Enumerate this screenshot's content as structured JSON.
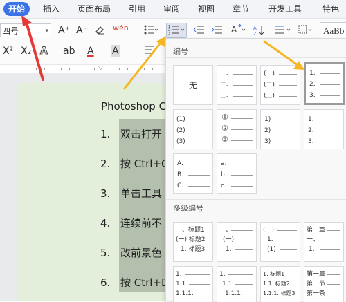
{
  "menubar": {
    "tabs": [
      "开始",
      "插入",
      "页面布局",
      "引用",
      "审阅",
      "视图",
      "章节",
      "开发工具",
      "特色"
    ]
  },
  "toolbar": {
    "font_size_value": "四号",
    "grow_font": "A⁺",
    "shrink_font": "A⁻",
    "phonetic": "wén",
    "superscript": "X²",
    "subscript": "X₂",
    "outline_text": "A",
    "highlight_text": "ab",
    "font_color_text": "A",
    "char_shading_text": "A",
    "sort_label": "AZ",
    "style_preview": "AaBb"
  },
  "colors": {
    "accent": "#3b73e6",
    "annotation_red": "#e53935",
    "annotation_orange": "#f5b622",
    "doc_page": "#e3efdb",
    "selection": "#b4c0ae"
  },
  "icons": {
    "bullet_list": "bulleted-list-icon",
    "numbered_list": "numbered-list-icon",
    "indent_decrease": "decrease-indent-icon",
    "indent_increase": "increase-indent-icon",
    "eraser": "eraser-icon",
    "line_spacing": "line-spacing-icon",
    "sort": "sort-icon"
  },
  "document": {
    "title": "Photoshop C",
    "items": [
      {
        "num": "1.",
        "text": "双击打开"
      },
      {
        "num": "2.",
        "text": "按 Ctrl+O"
      },
      {
        "num": "3.",
        "text": "单击工具"
      },
      {
        "num": "4.",
        "text": "连续前不"
      },
      {
        "num": "5.",
        "text": "改前景色"
      },
      {
        "num": "6.",
        "text": "按 Ctrl+D"
      }
    ]
  },
  "numbering_panel": {
    "section_numbering": "编号",
    "section_multilevel": "多级编号",
    "none_label": "无",
    "cards": [
      {
        "id": "none",
        "markers": []
      },
      {
        "id": "chinese-comma",
        "markers": [
          "一、",
          "二、",
          "三、"
        ]
      },
      {
        "id": "chinese-paren",
        "markers": [
          "(一)",
          "(二)",
          "(三)"
        ]
      },
      {
        "id": "arabic-dot",
        "markers": [
          "1.",
          "2.",
          "3."
        ]
      },
      {
        "id": "arabic-paren",
        "markers": [
          "(1)",
          "(2)",
          "(3)"
        ]
      },
      {
        "id": "circled",
        "markers": [
          "①",
          "②",
          "③"
        ]
      },
      {
        "id": "arabic-rparen",
        "markers": [
          "1)",
          "2)",
          "3)"
        ]
      },
      {
        "id": "arabic-dot-2",
        "markers": [
          "1.",
          "2.",
          "3."
        ]
      },
      {
        "id": "upper-alpha",
        "markers": [
          "A.",
          "B.",
          "C."
        ]
      },
      {
        "id": "lower-alpha",
        "markers": [
          "a.",
          "b.",
          "c."
        ]
      }
    ],
    "multilevel_cards": [
      {
        "id": "ml-heading",
        "lines": [
          "一、标题1",
          "(一) 标题2",
          "1. 标题3"
        ]
      },
      {
        "id": "ml-chinese",
        "lines": [
          "一、",
          "(一)",
          "1."
        ]
      },
      {
        "id": "ml-mixed",
        "lines": [
          "(一)",
          "1.",
          "(1)"
        ]
      },
      {
        "id": "ml-chapter",
        "lines": [
          "第一章",
          "一、",
          "1."
        ]
      }
    ],
    "multilevel_cards_row2": [
      {
        "id": "ml-decimal",
        "lines": [
          "1.",
          "1.1.",
          "1.1.1."
        ]
      },
      {
        "id": "ml-decimal-2",
        "lines": [
          "1.",
          "1.1.",
          "1.1.1."
        ]
      },
      {
        "id": "ml-heading-2",
        "lines": [
          "1. 标题1",
          "1.1. 标题2",
          "1.1.1. 标题3"
        ]
      },
      {
        "id": "ml-chapter-2",
        "lines": [
          "第一章",
          "第一节",
          "第一条"
        ]
      }
    ]
  }
}
